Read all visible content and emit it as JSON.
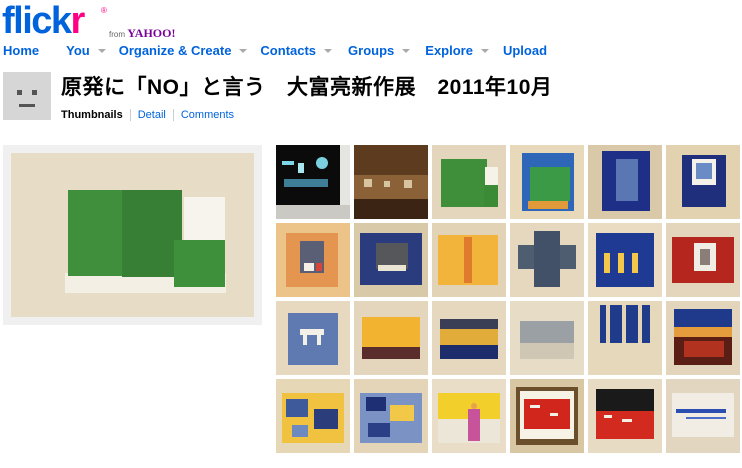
{
  "logo": {
    "word_part1": "flick",
    "word_part2": "r",
    "registered": "®",
    "from": "from",
    "yahoo": "YAHOO!"
  },
  "nav": {
    "items": [
      {
        "label": "Home",
        "dropdown": false
      },
      {
        "label": "You",
        "dropdown": true
      },
      {
        "label": "Organize & Create",
        "dropdown": true
      },
      {
        "label": "Contacts",
        "dropdown": true
      },
      {
        "label": "Groups",
        "dropdown": true
      },
      {
        "label": "Explore",
        "dropdown": true
      },
      {
        "label": "Upload",
        "dropdown": false
      }
    ]
  },
  "set": {
    "title": "原発に「NO」と言う　大富亮新作展　2011年10月"
  },
  "views": {
    "thumbnails": "Thumbnails",
    "detail": "Detail",
    "comments": "Comments"
  },
  "colors": {
    "flickr_blue": "#0063dc",
    "flickr_pink": "#ff0084",
    "yahoo_purple": "#7b0099",
    "wall": "#e7dcc6"
  },
  "thumbnails": [
    {
      "motif": "exhibition-sign-photo"
    },
    {
      "motif": "gallery-room-photo"
    },
    {
      "motif": "green-painting"
    },
    {
      "motif": "green-blue-painting"
    },
    {
      "motif": "blue-panel-painting"
    },
    {
      "motif": "blue-white-frame-painting"
    },
    {
      "motif": "orange-square-painting"
    },
    {
      "motif": "dark-blue-square-painting"
    },
    {
      "motif": "yellow-orange-painting"
    },
    {
      "motif": "grey-cross-painting"
    },
    {
      "motif": "blue-yellow-strips-painting"
    },
    {
      "motif": "red-white-frame-painting"
    },
    {
      "motif": "blue-gate-painting"
    },
    {
      "motif": "yellow-brown-painting"
    },
    {
      "motif": "dark-landscape-painting"
    },
    {
      "motif": "pale-grey-painting"
    },
    {
      "motif": "vertical-blue-strips-painting"
    },
    {
      "motif": "red-brown-sunset-painting"
    },
    {
      "motif": "blue-yellow-collage-painting"
    },
    {
      "motif": "blue-collage-painting"
    },
    {
      "motif": "yellow-figure-painting"
    },
    {
      "motif": "framed-red-painting"
    },
    {
      "motif": "red-dark-landscape-painting"
    },
    {
      "motif": "blue-wave-painting"
    }
  ]
}
